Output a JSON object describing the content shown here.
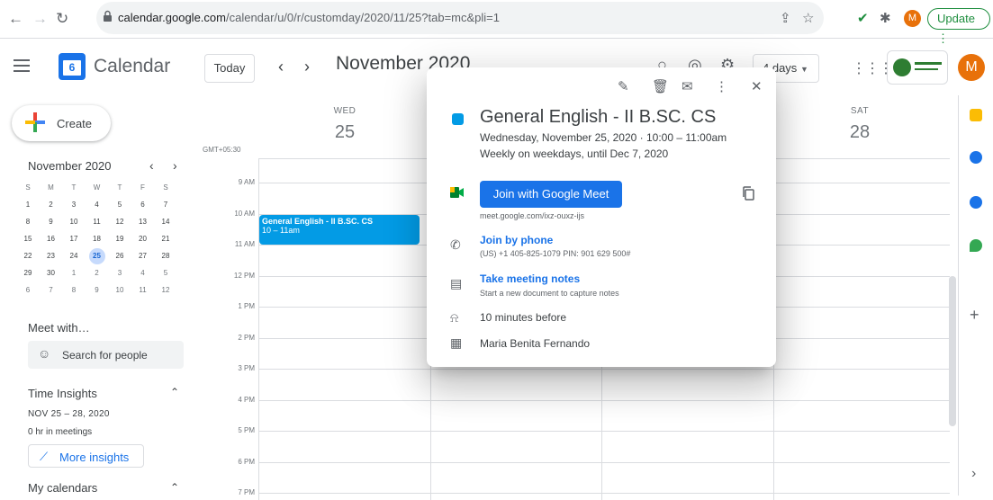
{
  "browser": {
    "url_host": "calendar.google.com",
    "url_path": "/calendar/u/0/r/customday/2020/11/25?tab=mc&pli=1",
    "profile_initial": "M",
    "update_label": "Update"
  },
  "header": {
    "app_name": "Calendar",
    "logo_day": "6",
    "today_label": "Today",
    "period": "November 2020",
    "view": "4 days",
    "avatar_initial": "M"
  },
  "sidebar": {
    "create_label": "Create",
    "mini_month": "November 2020",
    "mini_headers": [
      "S",
      "M",
      "T",
      "W",
      "T",
      "F",
      "S"
    ],
    "mini_weeks": [
      [
        "1",
        "2",
        "3",
        "4",
        "5",
        "6",
        "7"
      ],
      [
        "8",
        "9",
        "10",
        "11",
        "12",
        "13",
        "14"
      ],
      [
        "15",
        "16",
        "17",
        "18",
        "19",
        "20",
        "21"
      ],
      [
        "22",
        "23",
        "24",
        "25",
        "26",
        "27",
        "28"
      ],
      [
        "29",
        "30",
        "1",
        "2",
        "3",
        "4",
        "5"
      ],
      [
        "6",
        "7",
        "8",
        "9",
        "10",
        "11",
        "12"
      ]
    ],
    "meet_title": "Meet with…",
    "search_people": "Search for people",
    "time_insights_title": "Time Insights",
    "insights_range": "NOV 25 – 28, 2020",
    "insights_meetings": "0 hr in meetings",
    "more_insights": "More insights",
    "my_calendars": "My calendars"
  },
  "grid": {
    "timezone": "GMT+05:30",
    "days": [
      {
        "dow": "WED",
        "num": "25"
      },
      {
        "dow": "",
        "num": ""
      },
      {
        "dow": "",
        "num": ""
      },
      {
        "dow": "SAT",
        "num": "28"
      }
    ],
    "hours": [
      "9 AM",
      "10 AM",
      "11 AM",
      "12 PM",
      "1 PM",
      "2 PM",
      "3 PM",
      "4 PM",
      "5 PM",
      "6 PM",
      "7 PM"
    ],
    "event": {
      "title": "General English - II B.SC. CS",
      "time": "10 – 11am"
    }
  },
  "popup": {
    "title": "General English - II B.SC. CS",
    "when": "Wednesday, November 25, 2020  ·  10:00 – 11:00am",
    "recurrence": "Weekly on weekdays, until Dec 7, 2020",
    "join_label": "Join with Google Meet",
    "meet_link": "meet.google.com/ixz-ouxz-ijs",
    "phone_label": "Join by phone",
    "phone_detail": "(US) +1 405-825-1079 PIN: 901 629 500#",
    "notes_label": "Take meeting notes",
    "notes_detail": "Start a new document to capture notes",
    "reminder": "10 minutes before",
    "organizer": "Maria Benita Fernando"
  },
  "colors": {
    "event": "#039be5",
    "accent": "#1a73e8",
    "avatar": "#e8710a"
  }
}
